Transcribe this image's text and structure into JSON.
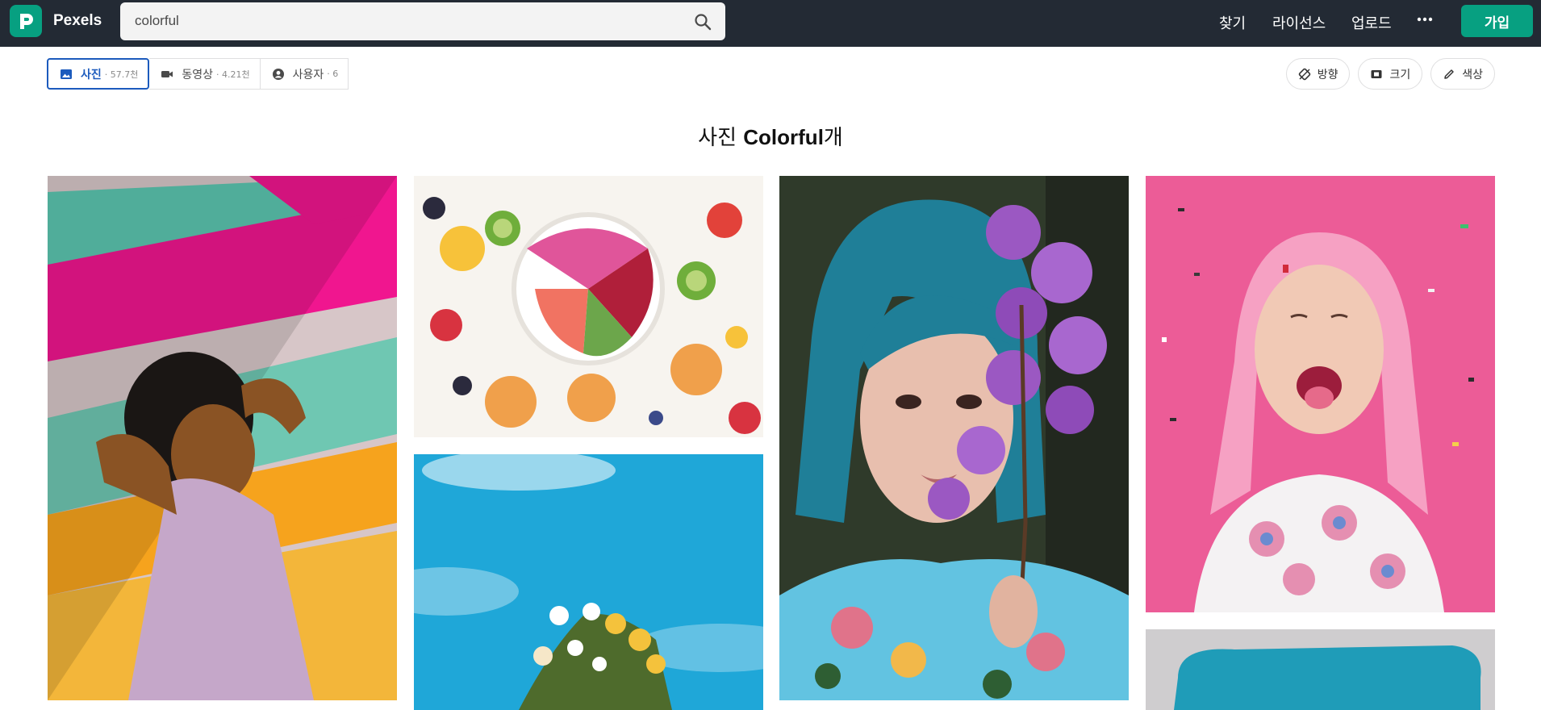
{
  "header": {
    "logo_letter": "P",
    "brand": "Pexels",
    "search": {
      "value": "colorful"
    },
    "nav": [
      "찾기",
      "라이선스",
      "업로드"
    ],
    "more_label": "•••",
    "join_label": "가입"
  },
  "tabs": [
    {
      "label": "사진",
      "count": "· 57.7천"
    },
    {
      "label": "동영상",
      "count": "· 4.21천"
    },
    {
      "label": "사용자",
      "count": "· 6"
    }
  ],
  "filters": [
    "방향",
    "크기",
    "색상"
  ],
  "title": {
    "prefix": "사진 ",
    "query": "Colorful",
    "suffix": "개"
  },
  "colors": {
    "brand": "#07a081",
    "topbar": "#232a34",
    "active_tab": "#1c5bbd"
  }
}
